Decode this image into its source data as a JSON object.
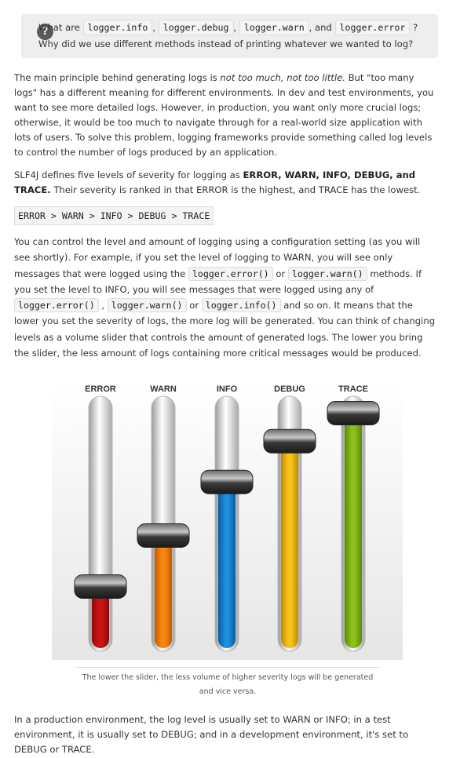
{
  "question": {
    "icon": "question-mark-icon",
    "icon_glyph": "?",
    "line1_prefix": "What are",
    "code_info": "logger.info",
    "sep1": ",",
    "code_debug": "logger.debug",
    "sep2": ",",
    "code_warn": "logger.warn",
    "and_word": ", and",
    "code_error": "logger.error",
    "qmark": "?",
    "line2": "Why did we use different methods instead of printing whatever we wanted to log?"
  },
  "para1": {
    "a": "The main principle behind generating logs is ",
    "em": "not too much, not too little.",
    "b": " But \"too many logs\" has a different meaning for different environments. In dev and test environments, you want to see more detailed logs. However, in production, you want only more crucial logs; otherwise, it would be too much to navigate through for a real-world size application with lots of users. To solve this problem, logging frameworks provide something called log levels to control the number of logs produced by an application."
  },
  "para2": {
    "a": "SLF4J defines five levels of severity for logging as ",
    "strong": "ERROR, WARN, INFO, DEBUG, and TRACE.",
    "b": " Their severity is ranked in that ERROR is the highest, and TRACE has the lowest."
  },
  "ordering": "ERROR > WARN > INFO > DEBUG > TRACE",
  "para3": {
    "a": "You can control the level and amount of logging using a configuration setting (as you will see shortly). For example, if you set the level of logging to WARN, you will see only messages that were logged using the ",
    "code1": "logger.error()",
    "b": " or ",
    "code2": "logger.warn()",
    "c": " methods. If you set the level to INFO, you will see messages that were logged using any of ",
    "code3": "logger.error()",
    "d": " , ",
    "code4": "logger.warn()",
    "e": " or ",
    "code5": "logger.info()",
    "f": " and so on. It means that the lower you set the severity of logs, the more log will be generated. You can think of changing levels as a volume slider that controls the amount of generated logs. The lower you bring the slider, the less amount of logs containing more critical messages would be produced."
  },
  "sliders": [
    {
      "label": "ERROR",
      "level": 0.3,
      "color": "#cc1414",
      "dark": "#8a0a0a"
    },
    {
      "label": "WARN",
      "level": 0.5,
      "color": "#f7880f",
      "dark": "#c25a00"
    },
    {
      "label": "INFO",
      "level": 0.71,
      "color": "#1e8ee0",
      "dark": "#0b5aa0"
    },
    {
      "label": "DEBUG",
      "level": 0.87,
      "color": "#f5c417",
      "dark": "#c08a00"
    },
    {
      "label": "TRACE",
      "level": 0.98,
      "color": "#8cbf1a",
      "dark": "#5a8a0a"
    }
  ],
  "caption": "The lower the slider, the less volume of higher severity logs will be generated and vice versa.",
  "para4": "In a production environment, the log level is usually set to WARN or INFO; in a test environment, it is usually set to DEBUG; and in a development environment, it's set to DEBUG or TRACE."
}
